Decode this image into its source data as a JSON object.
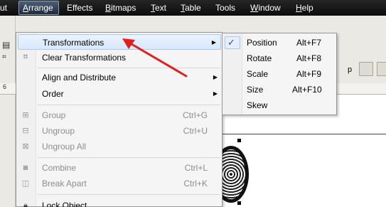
{
  "menubar": {
    "items": [
      {
        "label": "ut",
        "mnemonic": "",
        "rest": "ut"
      },
      {
        "label": "Arrange",
        "mnemonic": "A",
        "rest": "rrange"
      },
      {
        "label": "Effects",
        "mnemonic": "",
        "rest": "Effects"
      },
      {
        "label": "Bitmaps",
        "mnemonic": "B",
        "rest": "itmaps"
      },
      {
        "label": "Text",
        "mnemonic": "T",
        "rest": "ext"
      },
      {
        "label": "Table",
        "mnemonic": "T",
        "rest": "able"
      },
      {
        "label": "Tools",
        "mnemonic": "",
        "rest": "Tools"
      },
      {
        "label": "Window",
        "mnemonic": "W",
        "rest": "indow"
      },
      {
        "label": "Help",
        "mnemonic": "H",
        "rest": "elp"
      }
    ]
  },
  "arrange_menu": {
    "items": [
      {
        "label": "Transformations",
        "shortcut": "",
        "submenu": true,
        "highlighted": true,
        "disabled": false
      },
      {
        "label": "Clear Transformations",
        "shortcut": "",
        "submenu": false,
        "disabled": false
      },
      {
        "label": "Align and Distribute",
        "shortcut": "",
        "submenu": true,
        "disabled": false
      },
      {
        "label": "Order",
        "shortcut": "",
        "submenu": true,
        "disabled": false
      },
      {
        "label": "Group",
        "shortcut": "Ctrl+G",
        "submenu": false,
        "disabled": true
      },
      {
        "label": "Ungroup",
        "shortcut": "Ctrl+U",
        "submenu": false,
        "disabled": true
      },
      {
        "label": "Ungroup All",
        "shortcut": "",
        "submenu": false,
        "disabled": true
      },
      {
        "label": "Combine",
        "shortcut": "Ctrl+L",
        "submenu": false,
        "disabled": true
      },
      {
        "label": "Break  Apart",
        "shortcut": "Ctrl+K",
        "submenu": false,
        "disabled": true
      },
      {
        "label": "Lock Object",
        "shortcut": "",
        "submenu": false,
        "disabled": false
      }
    ]
  },
  "transform_submenu": {
    "items": [
      {
        "label": "Position",
        "shortcut": "Alt+F7",
        "checked": true
      },
      {
        "label": "Rotate",
        "shortcut": "Alt+F8",
        "checked": false
      },
      {
        "label": "Scale",
        "shortcut": "Alt+F9",
        "checked": false
      },
      {
        "label": "Size",
        "shortcut": "Alt+F10",
        "checked": false
      },
      {
        "label": "Skew",
        "shortcut": "",
        "checked": false
      }
    ]
  },
  "background": {
    "toolbar_text": "p",
    "ruler_tick": "6"
  },
  "icons": {
    "check": "✓",
    "submenu_arrow": "▶"
  },
  "colors": {
    "menubar": "#1a1a1a",
    "highlight": "#dce9fa",
    "annotation": "#e02020"
  }
}
